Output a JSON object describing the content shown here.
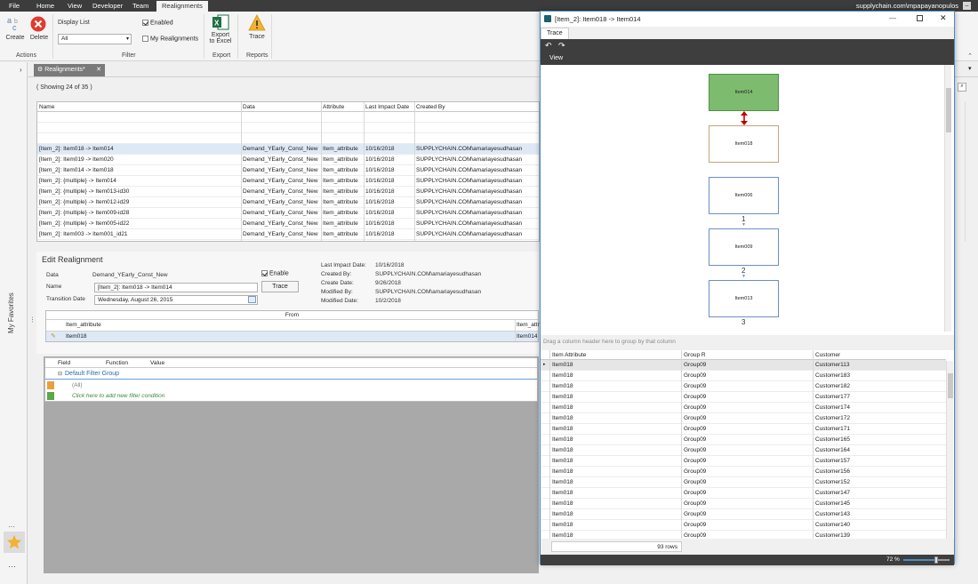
{
  "menu": {
    "file": "File",
    "home": "Home",
    "view": "View",
    "developer": "Developer",
    "team": "Team",
    "realignments": "Realignments",
    "user": "supplychain.com\\mpapayanopulos"
  },
  "ribbon": {
    "create": "Create",
    "delete": "Delete",
    "display_list": "Display List",
    "display_value": "All",
    "enabled": "Enabled",
    "my_realignments": "My Realignments",
    "export_excel_1": "Export",
    "export_excel_2": "to Excel",
    "trace": "Trace",
    "group_actions": "Actions",
    "group_filter": "Filter",
    "group_export": "Export",
    "group_reports": "Reports"
  },
  "sidebar": {
    "favorites": "My Favorites"
  },
  "doc_tab": {
    "label": "Realignments*"
  },
  "main": {
    "showing": "( Showing 24 of 35 )",
    "columns": [
      "Name",
      "Data",
      "Attribute",
      "Last Impact Date",
      "Created By"
    ],
    "rows": [
      [
        "[Item_2]: Item018 -> Item014",
        "Demand_YEarly_Const_New",
        "Item_attribute",
        "10/16/2018",
        "SUPPLYCHAIN.COM\\amariayesudhasan"
      ],
      [
        "[Item_2]: Item019 -> Item020",
        "Demand_YEarly_Const_New",
        "Item_attribute",
        "10/16/2018",
        "SUPPLYCHAIN.COM\\amariayesudhasan"
      ],
      [
        "[Item_2]: Item014 -> Item018",
        "Demand_YEarly_Const_New",
        "Item_attribute",
        "10/16/2018",
        "SUPPLYCHAIN.COM\\amariayesudhasan"
      ],
      [
        "[Item_2]: {multiple} -> Item014",
        "Demand_YEarly_Const_New",
        "Item_attribute",
        "10/16/2018",
        "SUPPLYCHAIN.COM\\amariayesudhasan"
      ],
      [
        "[Item_2]: {multiple} -> Item013-id30",
        "Demand_YEarly_Const_New",
        "Item_attribute",
        "10/16/2018",
        "SUPPLYCHAIN.COM\\amariayesudhasan"
      ],
      [
        "[Item_2]: {multiple} -> Item012-id29",
        "Demand_YEarly_Const_New",
        "Item_attribute",
        "10/16/2018",
        "SUPPLYCHAIN.COM\\amariayesudhasan"
      ],
      [
        "[Item_2]: {multiple} -> Item009-id28",
        "Demand_YEarly_Const_New",
        "Item_attribute",
        "10/16/2018",
        "SUPPLYCHAIN.COM\\amariayesudhasan"
      ],
      [
        "[Item_2]: {multiple} -> Item005-id22",
        "Demand_YEarly_Const_New",
        "Item_attribute",
        "10/16/2018",
        "SUPPLYCHAIN.COM\\amariayesudhasan"
      ],
      [
        "[Item_2]: Item003 -> Item001_id21",
        "Demand_YEarly_Const_New",
        "Item_attribute",
        "10/16/2018",
        "SUPPLYCHAIN.COM\\amariayesudhasan"
      ]
    ]
  },
  "edit": {
    "title": "Edit Realignment",
    "data_label": "Data",
    "data_value": "Demand_YEarly_Const_New",
    "name_label": "Name",
    "name_value": "[Item_2]: Item018 -> Item014",
    "transition_label": "Transition Date",
    "transition_value": "Wednesday, August 26, 2015",
    "enable_label": "Enable",
    "trace_button": "Trace",
    "last_impact_label": "Last Impact Date:",
    "last_impact_value": "10/16/2018",
    "created_by_label": "Created By:",
    "created_by_value": "SUPPLYCHAIN.COM\\amariayesudhasan",
    "create_date_label": "Create Date:",
    "create_date_value": "9/26/2018",
    "modified_by_label": "Modified By:",
    "modified_by_value": "SUPPLYCHAIN.COM\\amariayesudhasan",
    "modified_date_label": "Modified Date:",
    "modified_date_value": "10/2/2018",
    "from_header": "From",
    "from_attribute": "Item_attribute",
    "from_attribute_right": "Item_attr",
    "from_value": "Item018",
    "from_value_right": "Item014"
  },
  "filter": {
    "col_field": "Field",
    "col_function": "Function",
    "col_value": "Value",
    "group": "Default Filter Group",
    "all": "(All)",
    "add_hint": "Click here to add new filter condition"
  },
  "popup": {
    "title": "[Item_2]: Item018 -> Item014",
    "tab": "Trace",
    "view": "View",
    "nodes": [
      "Item014",
      "Item018",
      "Item006",
      "Item009",
      "Item013"
    ],
    "edge_labels": [
      "1",
      "2",
      "3"
    ],
    "drag_hint": "Drag a column header here to group by that column",
    "grid_columns": [
      "Item Attribute",
      "Group R",
      "Customer"
    ],
    "grid_rows": [
      [
        "Item018",
        "Group09",
        "Customer113"
      ],
      [
        "Item018",
        "Group09",
        "Customer183"
      ],
      [
        "Item018",
        "Group09",
        "Customer182"
      ],
      [
        "Item018",
        "Group09",
        "Customer177"
      ],
      [
        "Item018",
        "Group09",
        "Customer174"
      ],
      [
        "Item018",
        "Group09",
        "Customer172"
      ],
      [
        "Item018",
        "Group09",
        "Customer171"
      ],
      [
        "Item018",
        "Group09",
        "Customer165"
      ],
      [
        "Item018",
        "Group09",
        "Customer164"
      ],
      [
        "Item018",
        "Group09",
        "Customer157"
      ],
      [
        "Item018",
        "Group09",
        "Customer156"
      ],
      [
        "Item018",
        "Group09",
        "Customer152"
      ],
      [
        "Item018",
        "Group09",
        "Customer147"
      ],
      [
        "Item018",
        "Group09",
        "Customer145"
      ],
      [
        "Item018",
        "Group09",
        "Customer143"
      ],
      [
        "Item018",
        "Group09",
        "Customer140"
      ],
      [
        "Item018",
        "Group09",
        "Customer139"
      ]
    ],
    "row_count": "93 rows",
    "zoom": "72 %",
    "zoom_fraction": 0.72
  },
  "colors": {
    "accent_green": "#7dbb6f",
    "arrow_red": "#c00000",
    "node_border": "#6b8fc7",
    "title_bar": "#3c3c3c"
  }
}
